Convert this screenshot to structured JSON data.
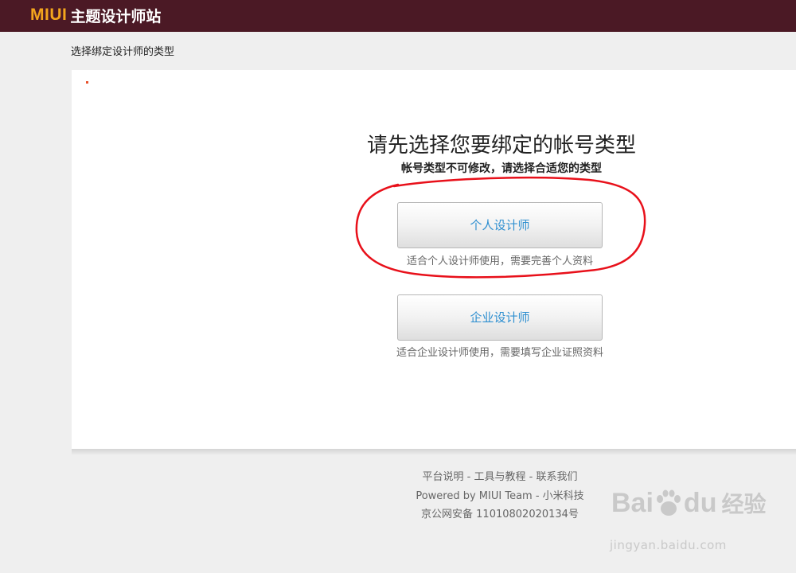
{
  "header": {
    "logo_miui": "MIUI",
    "logo_title": "主题设计师站"
  },
  "page": {
    "heading": "选择绑定设计师的类型",
    "title": "请先选择您要绑定的帐号类型",
    "subtitle": "帐号类型不可修改，请选择合适您的类型"
  },
  "account_types": [
    {
      "label": "个人设计师",
      "description": "适合个人设计师使用，需要完善个人资料"
    },
    {
      "label": "企业设计师",
      "description": "适合企业设计师使用，需要填写企业证照资料"
    }
  ],
  "footer": {
    "link_platform": "平台说明",
    "link_tutorial": "工具与教程",
    "link_contact": "联系我们",
    "separator": " - ",
    "powered": "Powered by MIUI Team - 小米科技",
    "icp": "京公网安备 11010802020134号"
  },
  "watermark": {
    "brand_left": "Bai",
    "brand_right": "du",
    "brand_cn": "经验",
    "url": "jingyan.baidu.com"
  },
  "colors": {
    "topbar": "#4b1925",
    "logo_accent": "#f3a51d",
    "button_text": "#2e8fd0",
    "annotation_red": "#e8101a"
  }
}
